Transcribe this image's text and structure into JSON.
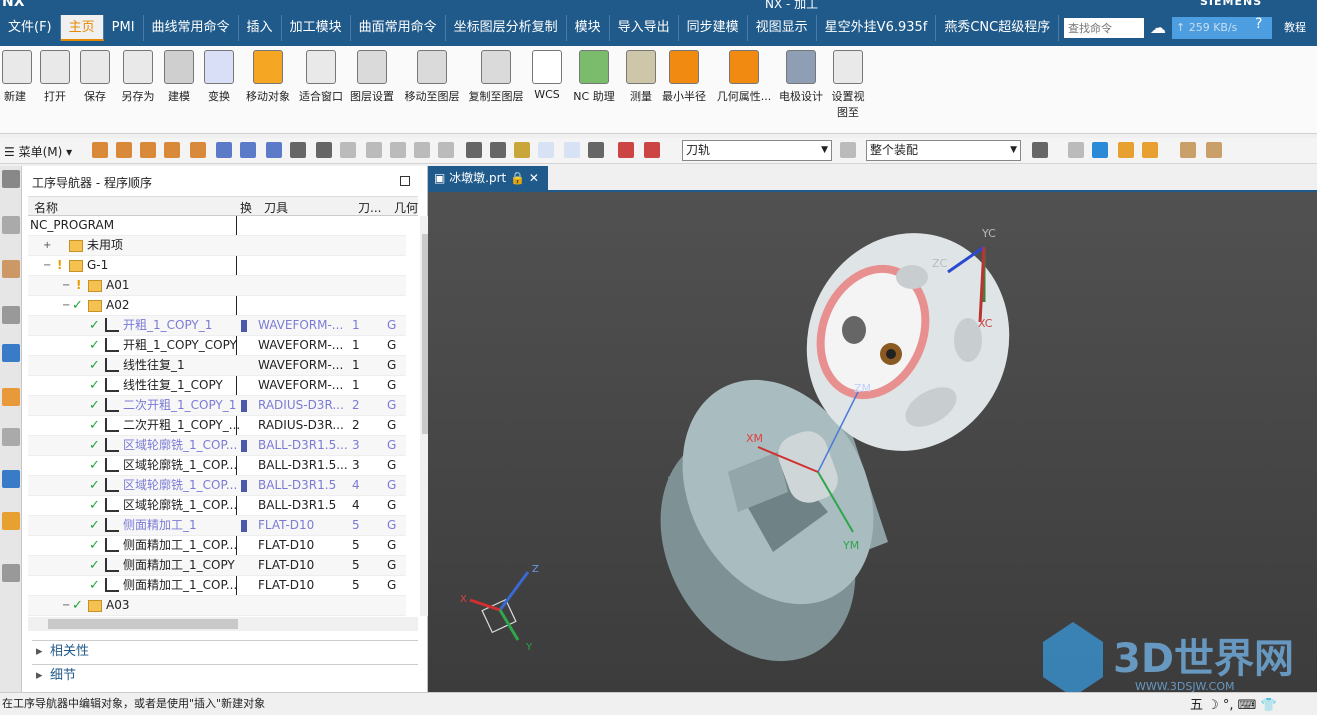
{
  "window": {
    "app": "NX",
    "title": "NX - 加工",
    "brand": "SIEMENS"
  },
  "menu": {
    "tabs": [
      "文件(F)",
      "主页",
      "PMI",
      "曲线常用命令",
      "插入",
      "加工模块",
      "曲面常用命令",
      "坐标图层分析复制",
      "模块",
      "导入导出",
      "同步建模",
      "视图显示",
      "星空外挂V6.935f",
      "燕秀CNC超级程序"
    ],
    "active": "主页",
    "search_placeholder": "查找命令",
    "speed": "259 KB/s",
    "help": "?",
    "teach": "教程"
  },
  "ribbon": {
    "buttons": [
      "新建",
      "打开",
      "保存",
      "另存为",
      "建模",
      "变换",
      "移动对象",
      "适合窗口",
      "图层设置",
      "移动至图层",
      "复制至图层",
      "WCS",
      "NC 助理",
      "测量",
      "最小半径",
      "几何属性...",
      "电极设计",
      "设置视图至"
    ]
  },
  "toolbar2": {
    "menu_label": "菜单(M)",
    "filter_value": "刀轨",
    "assembly_value": "整个装配"
  },
  "navigator": {
    "title": "工序导航器 - 程序顺序",
    "columns": {
      "name": "名称",
      "swap": "换",
      "tool": "刀具",
      "toolnum": "刀...",
      "geom": "几何"
    },
    "rows": [
      {
        "name": "NC_PROGRAM",
        "indent": 0,
        "type": "root",
        "tool": "",
        "num": "",
        "geom": "",
        "blue": false,
        "lock": false
      },
      {
        "name": "未用项",
        "indent": 1,
        "type": "folder",
        "tool": "",
        "num": "",
        "geom": "",
        "blue": false,
        "lock": false
      },
      {
        "name": "G-1",
        "indent": 1,
        "type": "folder",
        "tool": "",
        "num": "",
        "geom": "",
        "blue": false,
        "lock": false,
        "warn": true
      },
      {
        "name": "A01",
        "indent": 2,
        "type": "folder",
        "tool": "",
        "num": "",
        "geom": "",
        "blue": false,
        "lock": false,
        "warn": true
      },
      {
        "name": "A02",
        "indent": 2,
        "type": "folder",
        "tool": "",
        "num": "",
        "geom": "",
        "blue": false,
        "lock": false,
        "check": true
      },
      {
        "name": "开粗_1_COPY_1",
        "indent": 3,
        "type": "op",
        "tool": "WAVEFORM-...",
        "num": "1",
        "geom": "G",
        "blue": true,
        "lock": true
      },
      {
        "name": "开粗_1_COPY_COPY",
        "indent": 3,
        "type": "op",
        "tool": "WAVEFORM-...",
        "num": "1",
        "geom": "G",
        "blue": false,
        "lock": false
      },
      {
        "name": "线性往复_1",
        "indent": 3,
        "type": "op",
        "tool": "WAVEFORM-...",
        "num": "1",
        "geom": "G",
        "blue": false,
        "lock": false
      },
      {
        "name": "线性往复_1_COPY",
        "indent": 3,
        "type": "op",
        "tool": "WAVEFORM-...",
        "num": "1",
        "geom": "G",
        "blue": false,
        "lock": false
      },
      {
        "name": "二次开粗_1_COPY_1",
        "indent": 3,
        "type": "op",
        "tool": "RADIUS-D3R...",
        "num": "2",
        "geom": "G",
        "blue": true,
        "lock": true
      },
      {
        "name": "二次开粗_1_COPY_...",
        "indent": 3,
        "type": "op",
        "tool": "RADIUS-D3R...",
        "num": "2",
        "geom": "G",
        "blue": false,
        "lock": false
      },
      {
        "name": "区域轮廓铣_1_COP...",
        "indent": 3,
        "type": "op",
        "tool": "BALL-D3R1.5...",
        "num": "3",
        "geom": "G",
        "blue": true,
        "lock": true
      },
      {
        "name": "区域轮廓铣_1_COP...",
        "indent": 3,
        "type": "op",
        "tool": "BALL-D3R1.5...",
        "num": "3",
        "geom": "G",
        "blue": false,
        "lock": false
      },
      {
        "name": "区域轮廓铣_1_COP...",
        "indent": 3,
        "type": "op",
        "tool": "BALL-D3R1.5",
        "num": "4",
        "geom": "G",
        "blue": true,
        "lock": true
      },
      {
        "name": "区域轮廓铣_1_COP...",
        "indent": 3,
        "type": "op",
        "tool": "BALL-D3R1.5",
        "num": "4",
        "geom": "G",
        "blue": false,
        "lock": false
      },
      {
        "name": "侧面精加工_1",
        "indent": 3,
        "type": "op",
        "tool": "FLAT-D10",
        "num": "5",
        "geom": "G",
        "blue": true,
        "lock": true
      },
      {
        "name": "侧面精加工_1_COP...",
        "indent": 3,
        "type": "op",
        "tool": "FLAT-D10",
        "num": "5",
        "geom": "G",
        "blue": false,
        "lock": false
      },
      {
        "name": "侧面精加工_1_COPY",
        "indent": 3,
        "type": "op",
        "tool": "FLAT-D10",
        "num": "5",
        "geom": "G",
        "blue": false,
        "lock": false
      },
      {
        "name": "侧面精加工_1_COP...",
        "indent": 3,
        "type": "op",
        "tool": "FLAT-D10",
        "num": "5",
        "geom": "G",
        "blue": false,
        "lock": false
      },
      {
        "name": "A03",
        "indent": 2,
        "type": "folder",
        "tool": "",
        "num": "",
        "geom": "",
        "blue": false,
        "lock": false,
        "check": true
      }
    ],
    "sections": [
      "相关性",
      "细节"
    ]
  },
  "viewport": {
    "tab": "冰墩墩.prt",
    "labels": {
      "zc": "ZC",
      "yc": "YC",
      "xc": "XC",
      "zm": "ZM",
      "xm": "XM",
      "ym": "YM",
      "x": "X",
      "y": "Y",
      "z": "Z"
    },
    "watermark": "3D世界网",
    "watermark_url": "WWW.3DSJW.COM"
  },
  "status": {
    "text": "在工序导航器中编辑对象，或者是使用\"插入\"新建对象",
    "ime": "五 ☽ °, ⌨ 👕"
  }
}
